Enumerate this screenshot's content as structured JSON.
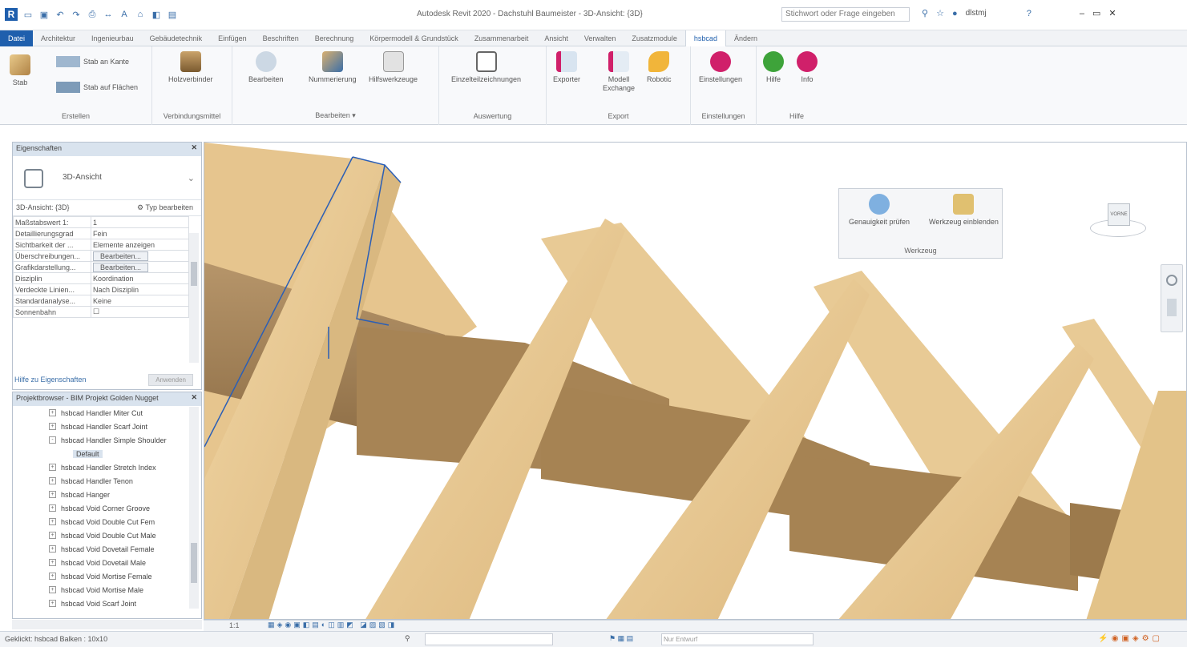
{
  "app": {
    "title": "Autodesk Revit 2020 - Dachstuhl Baumeister - 3D-Ansicht: {3D}",
    "search_placeholder": "Stichwort oder Frage eingeben",
    "user": "dlstmj"
  },
  "menu": [
    "Datei",
    "Architektur",
    "Ingenieurbau",
    "Gebäudetechnik",
    "Einfügen",
    "Beschriften",
    "Berechnung",
    "Körpermodell & Grundstück",
    "Zusammenarbeit",
    "Ansicht",
    "Verwalten",
    "Zusatzmodule",
    "hsbcad",
    "Ändern"
  ],
  "ribbon": {
    "buttons": {
      "stab": "Stab",
      "stab_kante": "Stab an Kante",
      "stab_flaechen": "Stab auf Flächen",
      "holzverbinder": "Holzverbinder",
      "bearbeiten": "Bearbeiten",
      "nummerierung": "Nummerierung",
      "hilfswerkzeuge": "Hilfswerkzeuge",
      "einzelteilzeichnungen": "Einzelteilzeichnungen",
      "exporter": "Exporter",
      "modell_exchange": "Modell Exchange",
      "robotic": "Robotic",
      "einstellungen": "Einstellungen",
      "hilfe": "Hilfe",
      "info": "Info"
    },
    "groups": {
      "erstellen": "Erstellen",
      "verbindungsmittel": "Verbindungsmittel",
      "bearbeiten": "Bearbeiten",
      "auswertung": "Auswertung",
      "export": "Export",
      "einstellungen": "Einstellungen",
      "hilfe": "Hilfe"
    }
  },
  "properties": {
    "title": "Eigenschaften",
    "type_name": "3D-Ansicht",
    "filter": "3D-Ansicht: {3D}",
    "edit_type": "Typ bearbeiten",
    "rows": [
      {
        "k": "Maßstabswert 1:",
        "v": "1"
      },
      {
        "k": "Detaillierungsgrad",
        "v": "Fein"
      },
      {
        "k": "Sichtbarkeit der ...",
        "v": "Elemente anzeigen"
      },
      {
        "k": "Überschreibungen...",
        "v": "Bearbeiten..."
      },
      {
        "k": "Grafikdarstellung...",
        "v": "Bearbeiten..."
      },
      {
        "k": "Disziplin",
        "v": "Koordination"
      },
      {
        "k": "Verdeckte Linien...",
        "v": "Nach Disziplin"
      },
      {
        "k": "Standardanalyse...",
        "v": "Keine"
      },
      {
        "k": "Sonnenbahn",
        "v": "☐"
      }
    ],
    "help": "Hilfe zu Eigenschaften",
    "apply": "Anwenden"
  },
  "browser": {
    "title": "Projektbrowser - BIM Projekt Golden Nugget",
    "items": [
      {
        "pm": "+",
        "label": "hsbcad Handler Miter Cut"
      },
      {
        "pm": "+",
        "label": "hsbcad Handler Scarf Joint"
      },
      {
        "pm": "-",
        "label": "hsbcad Handler Simple Shoulder"
      },
      {
        "pm": "",
        "label": "Default"
      },
      {
        "pm": "+",
        "label": "hsbcad Handler Stretch Index"
      },
      {
        "pm": "+",
        "label": "hsbcad Handler Tenon"
      },
      {
        "pm": "+",
        "label": "hsbcad Hanger"
      },
      {
        "pm": "+",
        "label": "hsbcad Void Corner Groove"
      },
      {
        "pm": "+",
        "label": "hsbcad Void Double Cut Fem"
      },
      {
        "pm": "+",
        "label": "hsbcad Void Double Cut Male"
      },
      {
        "pm": "+",
        "label": "hsbcad Void Dovetail Female"
      },
      {
        "pm": "+",
        "label": "hsbcad Void Dovetail Male"
      },
      {
        "pm": "+",
        "label": "hsbcad Void Mortise Female"
      },
      {
        "pm": "+",
        "label": "hsbcad Void Mortise Male"
      },
      {
        "pm": "+",
        "label": "hsbcad Void Scarf Joint"
      }
    ]
  },
  "floating_panel": {
    "btn1": "Genauigkeit prüfen",
    "btn2": "Werkzeug einblenden",
    "label": "Werkzeug"
  },
  "viewcube_label": "VORNE",
  "viewbar": {
    "scale": "1:1"
  },
  "status": {
    "text": "Geklickt: hsbcad Balken : 10x10",
    "workset": "Nur Entwurf"
  },
  "colors": {
    "accent": "#1f5fad",
    "wood": "#e9c791",
    "wood_dark": "#a78455"
  }
}
